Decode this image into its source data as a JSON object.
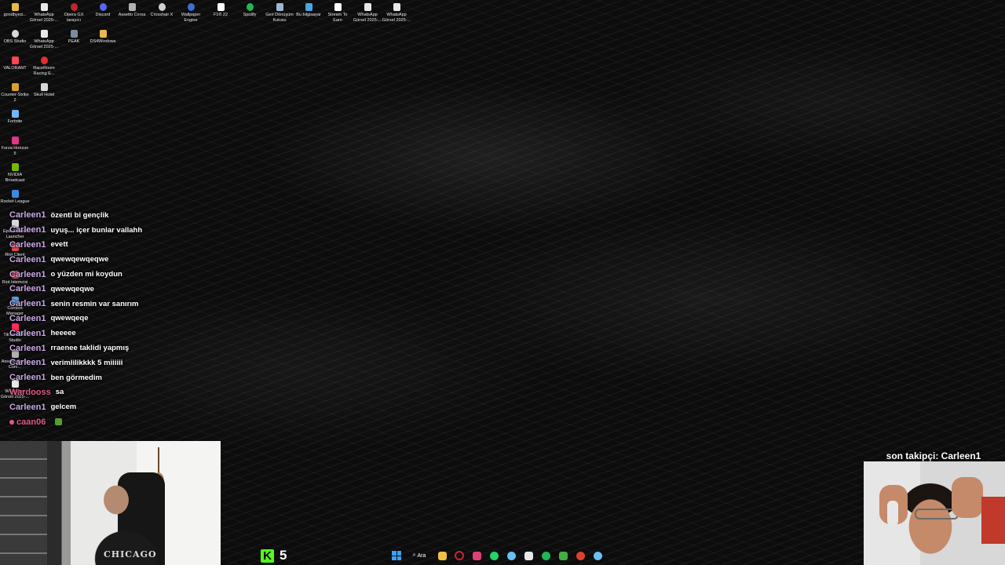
{
  "desktop": {
    "icons": [
      {
        "label": "goodbyed...",
        "color": "#e8b84a"
      },
      {
        "label": "WhatsApp Görsel 2025-...",
        "color": "#e8e8e8"
      },
      {
        "label": "Opera GX tarayıcı",
        "color": "#c0262e"
      },
      {
        "label": "Discord",
        "color": "#5865f2"
      },
      {
        "label": "Assetto Corsa",
        "color": "#b0b0b0"
      },
      {
        "label": "Crosshair X",
        "color": "#d0d0d0"
      },
      {
        "label": "Wallpaper Engine",
        "color": "#3b6fd6"
      },
      {
        "label": "F1® 22",
        "color": "#ffffff"
      },
      {
        "label": "Spotify",
        "color": "#1db954"
      },
      {
        "label": "Geri Dönüşüm Kutusu",
        "color": "#9fb6d6"
      },
      {
        "label": "Bu bilgisayar",
        "color": "#46a7e6"
      },
      {
        "label": "Stream To Earn",
        "color": "#ffffff"
      },
      {
        "label": "WhatsApp Görsel 2025-...",
        "color": "#e8e8e8"
      },
      {
        "label": "WhatsApp Görsel 2025-...",
        "color": "#e8e8e8"
      },
      {
        "label": "OBS Studio",
        "color": "#d8d8d8"
      },
      {
        "label": "WhatsApp Görsel 2025-...",
        "color": "#e8e8e8"
      },
      {
        "label": "PEAK",
        "color": "#7a8aa0"
      },
      {
        "label": "DS4Windows",
        "color": "#e8b84a"
      },
      {
        "label": "VALORANT",
        "color": "#ff4655"
      },
      {
        "label": "RaceRoom Racing E...",
        "color": "#e03030"
      },
      {
        "label": "Counter-Strike 2",
        "color": "#d8a030"
      },
      {
        "label": "Skull Hotel",
        "color": "#d8d8d8"
      },
      {
        "label": "Fortnite",
        "color": "#6fb7ff"
      },
      {
        "label": "Forza Horizon 5",
        "color": "#e0368a"
      },
      {
        "label": "NVIDIA Broadcast",
        "color": "#76b900"
      },
      {
        "label": "Rocket League",
        "color": "#3a8be0"
      },
      {
        "label": "Epic Games Launcher",
        "color": "#d8d8d8"
      },
      {
        "label": "Riot Client",
        "color": "#e04848"
      },
      {
        "label": "Riot İstemcisi",
        "color": "#e04848"
      },
      {
        "label": "Content Manager",
        "color": "#5a9ad6"
      },
      {
        "label": "TikTok LIVE Studio",
        "color": "#ff2b55"
      },
      {
        "label": "Assetto Corsa Com...",
        "color": "#b0b0b0"
      },
      {
        "label": "WhatsApp Görsel 2025-...",
        "color": "#e8e8e8"
      }
    ]
  },
  "chat": {
    "messages": [
      {
        "user": "Carleen1",
        "text": "özenti bi gençlik"
      },
      {
        "user": "Carleen1",
        "text": "uyuş... içer bunlar vallahh"
      },
      {
        "user": "Carleen1",
        "text": "evett"
      },
      {
        "user": "Carleen1",
        "text": "qwewqewqeqwe"
      },
      {
        "user": "Carleen1",
        "text": "o yüzden mi koydun"
      },
      {
        "user": "Carleen1",
        "text": "qwewqeqwe"
      },
      {
        "user": "Carleen1",
        "text": "senin resmin var sanırım"
      },
      {
        "user": "Carleen1",
        "text": "qwewqeqe"
      },
      {
        "user": "Carleen1",
        "text": "heeeee"
      },
      {
        "user": "Carleen1",
        "text": "rraenee taklidi yapmış"
      },
      {
        "user": "Carleen1",
        "text": "verimlilikkkk 5 miiiiii"
      },
      {
        "user": "Carleen1",
        "text": "ben görmedim"
      },
      {
        "user": "Wardooss",
        "text": "sa"
      },
      {
        "user": "Carleen1",
        "text": "gelcem"
      },
      {
        "user": "caan06",
        "text": ""
      }
    ]
  },
  "webcam_left": {
    "shirt_text": "CHICAGO"
  },
  "overlay": {
    "last_follower": "son takipçi: Carleen1"
  },
  "kick": {
    "logo": "K",
    "viewer_count": "5",
    "color": "#53fc18"
  },
  "taskbar": {
    "search_label": "Ara",
    "icons": [
      {
        "name": "windows-start-icon"
      },
      {
        "name": "search-icon"
      },
      {
        "name": "file-explorer-icon",
        "color": "#f0c040"
      },
      {
        "name": "opera-gx-icon",
        "color": "#d02030"
      },
      {
        "name": "instagram-icon",
        "color": "#e0407a"
      },
      {
        "name": "whatsapp-icon",
        "color": "#25d366"
      },
      {
        "name": "steam-icon",
        "color": "#66c0f4"
      },
      {
        "name": "tiktok-live-icon",
        "color": "#e8e8e8"
      },
      {
        "name": "spotify-icon",
        "color": "#1db954"
      },
      {
        "name": "xbox-icon",
        "color": "#40b040"
      },
      {
        "name": "chrome-icon",
        "color": "#e04030"
      },
      {
        "name": "steam-alt-icon",
        "color": "#66c0f4"
      }
    ]
  }
}
